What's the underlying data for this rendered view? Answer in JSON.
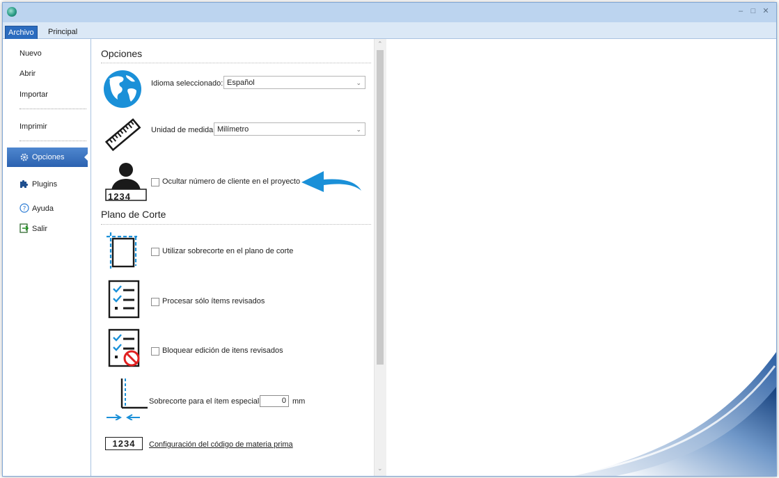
{
  "window": {
    "controls": [
      "–",
      "□",
      "✕"
    ]
  },
  "tabs": [
    {
      "label": "Archivo",
      "active": true
    },
    {
      "label": "Principal",
      "active": false
    }
  ],
  "sidebar": {
    "items": [
      {
        "label": "Nuevo"
      },
      {
        "label": "Abrir"
      },
      {
        "label": "Importar"
      },
      {
        "label": "Imprimir"
      },
      {
        "label": "Opciones",
        "icon": "gear-icon",
        "selected": true
      },
      {
        "label": "Plugins",
        "icon": "puzzle-icon"
      },
      {
        "label": "Ayuda",
        "icon": "help-icon"
      },
      {
        "label": "Salir",
        "icon": "exit-icon"
      }
    ]
  },
  "options": {
    "title": "Opciones",
    "language": {
      "label": "Idioma seleccionado:",
      "value": "Español",
      "icon": "globe-icon"
    },
    "unit": {
      "label": "Unidad de medida:",
      "value": "Milímetro",
      "icon": "ruler-icon"
    },
    "hide_client": {
      "label": "Ocultar número de cliente en el proyecto",
      "checked": false,
      "icon": "client-number-icon",
      "badge": "1234"
    }
  },
  "cutting": {
    "title": "Plano de Corte",
    "overcut": {
      "label": "Utilizar sobrecorte en el plano de corte",
      "checked": false,
      "icon": "overcut-icon"
    },
    "process_reviewed": {
      "label": "Procesar sólo ítems revisados",
      "checked": false,
      "icon": "checklist-icon"
    },
    "block_reviewed": {
      "label": "Bloquear edición de itens revisados",
      "checked": false,
      "icon": "checklist-blocked-icon"
    },
    "special_overcut": {
      "label": "Sobrecorte para el ítem especial",
      "value": "0",
      "unit": "mm",
      "icon": "special-overcut-icon"
    },
    "raw_code": {
      "badge": "1234",
      "link": "Configuración del código de materia prima",
      "icon": "code-badge-icon"
    }
  },
  "colors": {
    "accent": "#2b6cbf",
    "titlebar": "#bcd4ef",
    "icon_blue": "#1a90d8"
  }
}
